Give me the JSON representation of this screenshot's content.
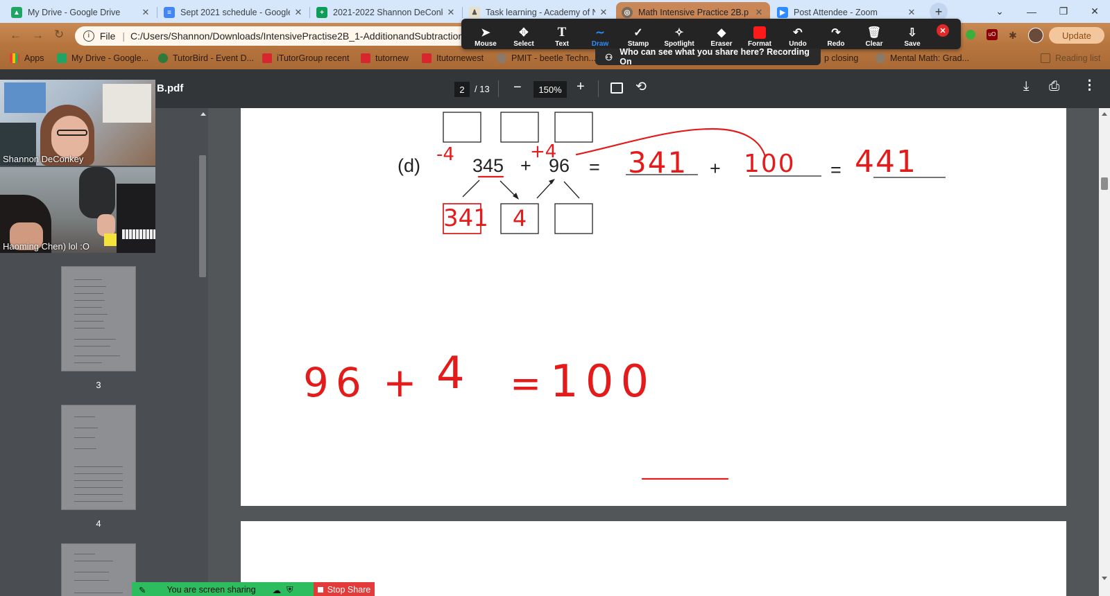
{
  "tabs": [
    {
      "title": "My Drive - Google Drive",
      "icon": "google-drive-icon",
      "color": "#1fa463"
    },
    {
      "title": "Sept 2021 schedule - Google",
      "icon": "google-docs-icon",
      "color": "#4285f4"
    },
    {
      "title": "2021-2022 Shannon DeConk",
      "icon": "google-sheets-icon",
      "color": "#0f9d58"
    },
    {
      "title": "Task learning - Academy of N",
      "icon": "academy-icon",
      "color": "#888888"
    },
    {
      "title": "Math Intensive Practice 2B.p",
      "icon": "globe-icon",
      "color": "#5f6368"
    },
    {
      "title": "Post Attendee - Zoom",
      "icon": "zoom-icon",
      "color": "#2d8cff"
    }
  ],
  "address_bar": {
    "scheme_label": "File",
    "url": "C:/Users/Shannon/Downloads/IntensivePractise2B_1-AdditionandSubtraction(N"
  },
  "bookmarks": [
    {
      "label": "Apps",
      "icon": "apps-grid-icon"
    },
    {
      "label": "My Drive - Google...",
      "icon": "google-drive-icon"
    },
    {
      "label": "TutorBird - Event D...",
      "icon": "tutorbird-icon"
    },
    {
      "label": "iTutorGroup recent",
      "icon": "itutor-icon"
    },
    {
      "label": "tutornew",
      "icon": "itutor-icon"
    },
    {
      "label": "Itutornewest",
      "icon": "itutor-icon"
    },
    {
      "label": "PMIT - beetle Techn...",
      "icon": "globe-icon"
    },
    {
      "label": "p closing",
      "icon": "globe-icon"
    },
    {
      "label": "Mental Math: Grad...",
      "icon": "globe-icon"
    },
    {
      "label": "Reading list",
      "icon": "reading-list-icon"
    }
  ],
  "update_button": "Update",
  "zoom_toolbar": {
    "tools": [
      "Mouse",
      "Select",
      "Text",
      "Draw",
      "Stamp",
      "Spotlight",
      "Eraser",
      "Format",
      "Undo",
      "Redo",
      "Clear",
      "Save"
    ],
    "active_tool": "Draw",
    "share_notice": "Who can see what you share here? Recording On"
  },
  "pdf": {
    "file_name": "B.pdf",
    "current_page": "2",
    "total_pages": "/ 13",
    "zoom": "150%"
  },
  "thumbnails": [
    "3",
    "4"
  ],
  "participants": [
    {
      "name": "Shannon DeConkey"
    },
    {
      "name": "Haoming Chen) lol :O"
    }
  ],
  "worksheet": {
    "label": "(d)",
    "num_a": "345",
    "num_b": "96",
    "plus": "+",
    "equals": "=",
    "answer_a": "341",
    "answer_b": "100",
    "answer_total": "441",
    "box_a": "341",
    "box_b": "4",
    "note_minus": "-4",
    "note_plus": "+4",
    "bottom_eq_a": "96",
    "bottom_eq_b": "4",
    "bottom_eq_c": "100"
  },
  "share_bar": {
    "sharing": "You are screen sharing",
    "stop": "Stop Share"
  }
}
